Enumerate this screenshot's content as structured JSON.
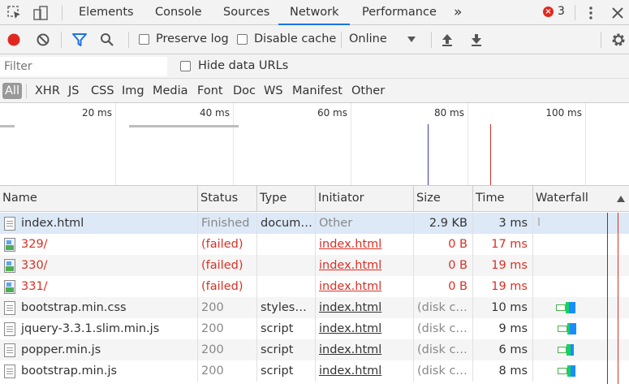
{
  "tabs": [
    {
      "label": "Elements"
    },
    {
      "label": "Console"
    },
    {
      "label": "Sources"
    },
    {
      "label": "Network",
      "active": true
    },
    {
      "label": "Performance"
    }
  ],
  "more_tabs": "»",
  "error_count": "3",
  "toolbar": {
    "preserve_log": "Preserve log",
    "disable_cache": "Disable cache",
    "throttle": "Online"
  },
  "filter": {
    "placeholder": "Filter",
    "hide_data_urls": "Hide data URLs"
  },
  "type_filters": [
    "All",
    "XHR",
    "JS",
    "CSS",
    "Img",
    "Media",
    "Font",
    "Doc",
    "WS",
    "Manifest",
    "Other"
  ],
  "overview_ticks": [
    "20 ms",
    "40 ms",
    "60 ms",
    "80 ms",
    "100 ms"
  ],
  "columns": {
    "name": "Name",
    "status": "Status",
    "type": "Type",
    "initiator": "Initiator",
    "size": "Size",
    "time": "Time",
    "waterfall": "Waterfall"
  },
  "rows": [
    {
      "name": "index.html",
      "status": "Finished",
      "type": "docum…",
      "initiator": "Other",
      "size": "2.9 KB",
      "time": "3 ms",
      "failed": false
    },
    {
      "name": "329/",
      "status": "(failed)",
      "type": "",
      "initiator": "index.html",
      "size": "0 B",
      "time": "17 ms",
      "failed": true
    },
    {
      "name": "330/",
      "status": "(failed)",
      "type": "",
      "initiator": "index.html",
      "size": "0 B",
      "time": "19 ms",
      "failed": true
    },
    {
      "name": "331/",
      "status": "(failed)",
      "type": "",
      "initiator": "index.html",
      "size": "0 B",
      "time": "19 ms",
      "failed": true
    },
    {
      "name": "bootstrap.min.css",
      "status": "200",
      "type": "styles…",
      "initiator": "index.html",
      "size": "(disk c…",
      "time": "10 ms",
      "failed": false
    },
    {
      "name": "jquery-3.3.1.slim.min.js",
      "status": "200",
      "type": "script",
      "initiator": "index.html",
      "size": "(disk c…",
      "time": "9 ms",
      "failed": false
    },
    {
      "name": "popper.min.js",
      "status": "200",
      "type": "script",
      "initiator": "index.html",
      "size": "(disk c…",
      "time": "6 ms",
      "failed": false
    },
    {
      "name": "bootstrap.min.js",
      "status": "200",
      "type": "script",
      "initiator": "index.html",
      "size": "(disk c…",
      "time": "8 ms",
      "failed": false
    }
  ],
  "colors": {
    "accent": "#1a73e8",
    "failed": "#d93025",
    "record": "#e0281e",
    "selected_row": "#dde9f7"
  }
}
